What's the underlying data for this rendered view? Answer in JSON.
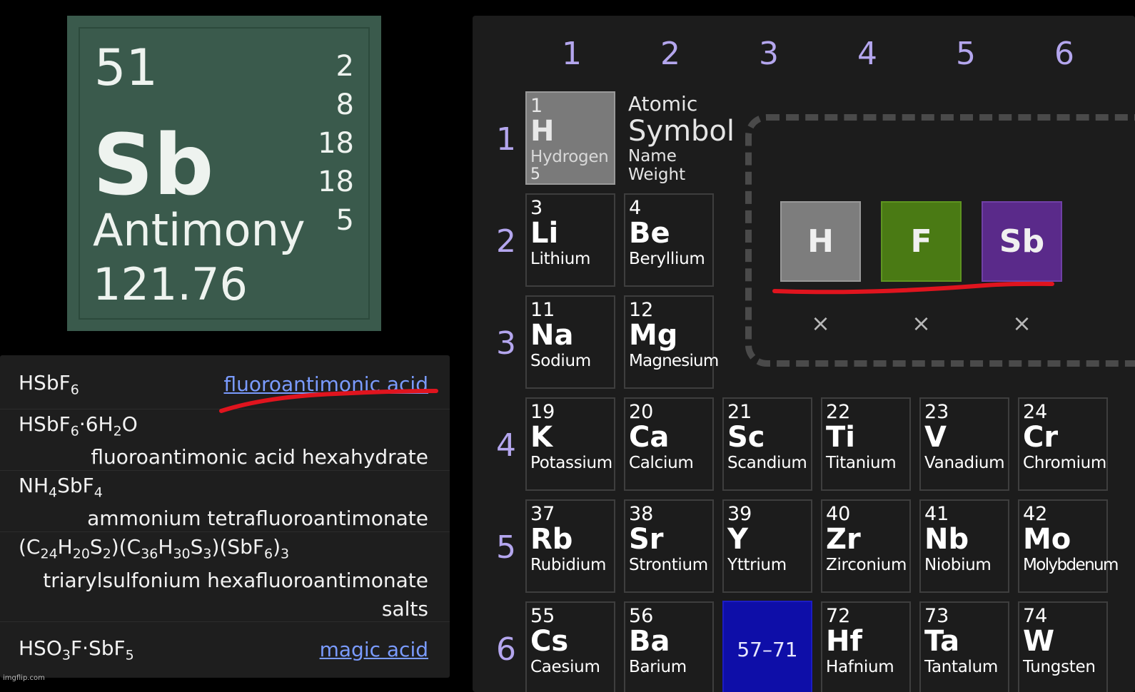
{
  "element": {
    "number": "51",
    "symbol": "Sb",
    "name": "Antimony",
    "weight": "121.76",
    "shells": [
      "2",
      "8",
      "18",
      "18",
      "5"
    ],
    "card_color": "#3a5a4c"
  },
  "compounds": [
    {
      "formula_parts": [
        [
          "HSbF",
          ""
        ],
        [
          "6",
          "sub"
        ]
      ],
      "name": "fluoroantimonic acid",
      "is_link": true
    },
    {
      "formula_parts": [
        [
          "HSbF",
          ""
        ],
        [
          "6",
          "sub"
        ],
        [
          "·6H",
          ""
        ],
        [
          "2",
          "sub"
        ],
        [
          "O",
          ""
        ]
      ],
      "name": "fluoroantimonic acid hexahydrate",
      "is_link": false
    },
    {
      "formula_parts": [
        [
          "NH",
          ""
        ],
        [
          "4",
          "sub"
        ],
        [
          "SbF",
          ""
        ],
        [
          "4",
          "sub"
        ]
      ],
      "name": "ammonium tetrafluoroantimonate",
      "is_link": false
    },
    {
      "formula_parts": [
        [
          "(C",
          ""
        ],
        [
          "24",
          "sub"
        ],
        [
          "H",
          ""
        ],
        [
          "20",
          "sub"
        ],
        [
          "S",
          ""
        ],
        [
          "2",
          "sub"
        ],
        [
          ")(C",
          ""
        ],
        [
          "36",
          "sub"
        ],
        [
          "H",
          ""
        ],
        [
          "30",
          "sub"
        ],
        [
          "S",
          ""
        ],
        [
          "3",
          "sub"
        ],
        [
          ")(SbF",
          ""
        ],
        [
          "6",
          "sub"
        ],
        [
          ")",
          ""
        ],
        [
          "3",
          "sub"
        ]
      ],
      "name_lines": [
        "triarylsulfonium hexafluoroantimonate",
        "salts"
      ],
      "is_link": false
    },
    {
      "formula_parts": [
        [
          "HSO",
          ""
        ],
        [
          "3",
          "sub"
        ],
        [
          "F·SbF",
          ""
        ],
        [
          "5",
          "sub"
        ]
      ],
      "name": "magic acid",
      "is_link": true
    }
  ],
  "watermark": "imgflip.com",
  "table": {
    "groups": [
      "1",
      "2",
      "3",
      "4",
      "5",
      "6"
    ],
    "periods": [
      "1",
      "2",
      "3",
      "4",
      "5",
      "6"
    ],
    "legend": {
      "number": "Atomic",
      "symbol": "Symbol",
      "name": "Name",
      "weight": "Weight"
    },
    "hydrogen": {
      "number": "1",
      "symbol": "H",
      "name": "Hydrogen",
      "weight": "5"
    },
    "elements": [
      {
        "number": "3",
        "symbol": "Li",
        "name": "Lithium"
      },
      {
        "number": "4",
        "symbol": "Be",
        "name": "Beryllium"
      },
      {
        "number": "11",
        "symbol": "Na",
        "name": "Sodium"
      },
      {
        "number": "12",
        "symbol": "Mg",
        "name": "Magnesium"
      },
      {
        "number": "19",
        "symbol": "K",
        "name": "Potassium"
      },
      {
        "number": "20",
        "symbol": "Ca",
        "name": "Calcium"
      },
      {
        "number": "21",
        "symbol": "Sc",
        "name": "Scandium"
      },
      {
        "number": "22",
        "symbol": "Ti",
        "name": "Titanium"
      },
      {
        "number": "23",
        "symbol": "V",
        "name": "Vanadium"
      },
      {
        "number": "24",
        "symbol": "Cr",
        "name": "Chromium"
      },
      {
        "number": "37",
        "symbol": "Rb",
        "name": "Rubidium"
      },
      {
        "number": "38",
        "symbol": "Sr",
        "name": "Strontium"
      },
      {
        "number": "39",
        "symbol": "Y",
        "name": "Yttrium"
      },
      {
        "number": "40",
        "symbol": "Zr",
        "name": "Zirconium"
      },
      {
        "number": "41",
        "symbol": "Nb",
        "name": "Niobium"
      },
      {
        "number": "42",
        "symbol": "Mo",
        "name": "Molybdenum"
      },
      {
        "number": "55",
        "symbol": "Cs",
        "name": "Caesium"
      },
      {
        "number": "56",
        "symbol": "Ba",
        "name": "Barium"
      },
      {
        "number": "72",
        "symbol": "Hf",
        "name": "Hafnium"
      },
      {
        "number": "73",
        "symbol": "Ta",
        "name": "Tantalum"
      },
      {
        "number": "74",
        "symbol": "W",
        "name": "Tungsten"
      }
    ],
    "lanthanides_label": "57–71",
    "lanthanides_color": "#0e0ea8"
  },
  "builder": {
    "tiles": [
      {
        "symbol": "H",
        "color": "#7d7d7d"
      },
      {
        "symbol": "F",
        "color": "#4a7a14"
      },
      {
        "symbol": "Sb",
        "color": "#5a2a8a"
      }
    ],
    "remove_glyph": "×"
  },
  "annotation_color": "#e0141e"
}
